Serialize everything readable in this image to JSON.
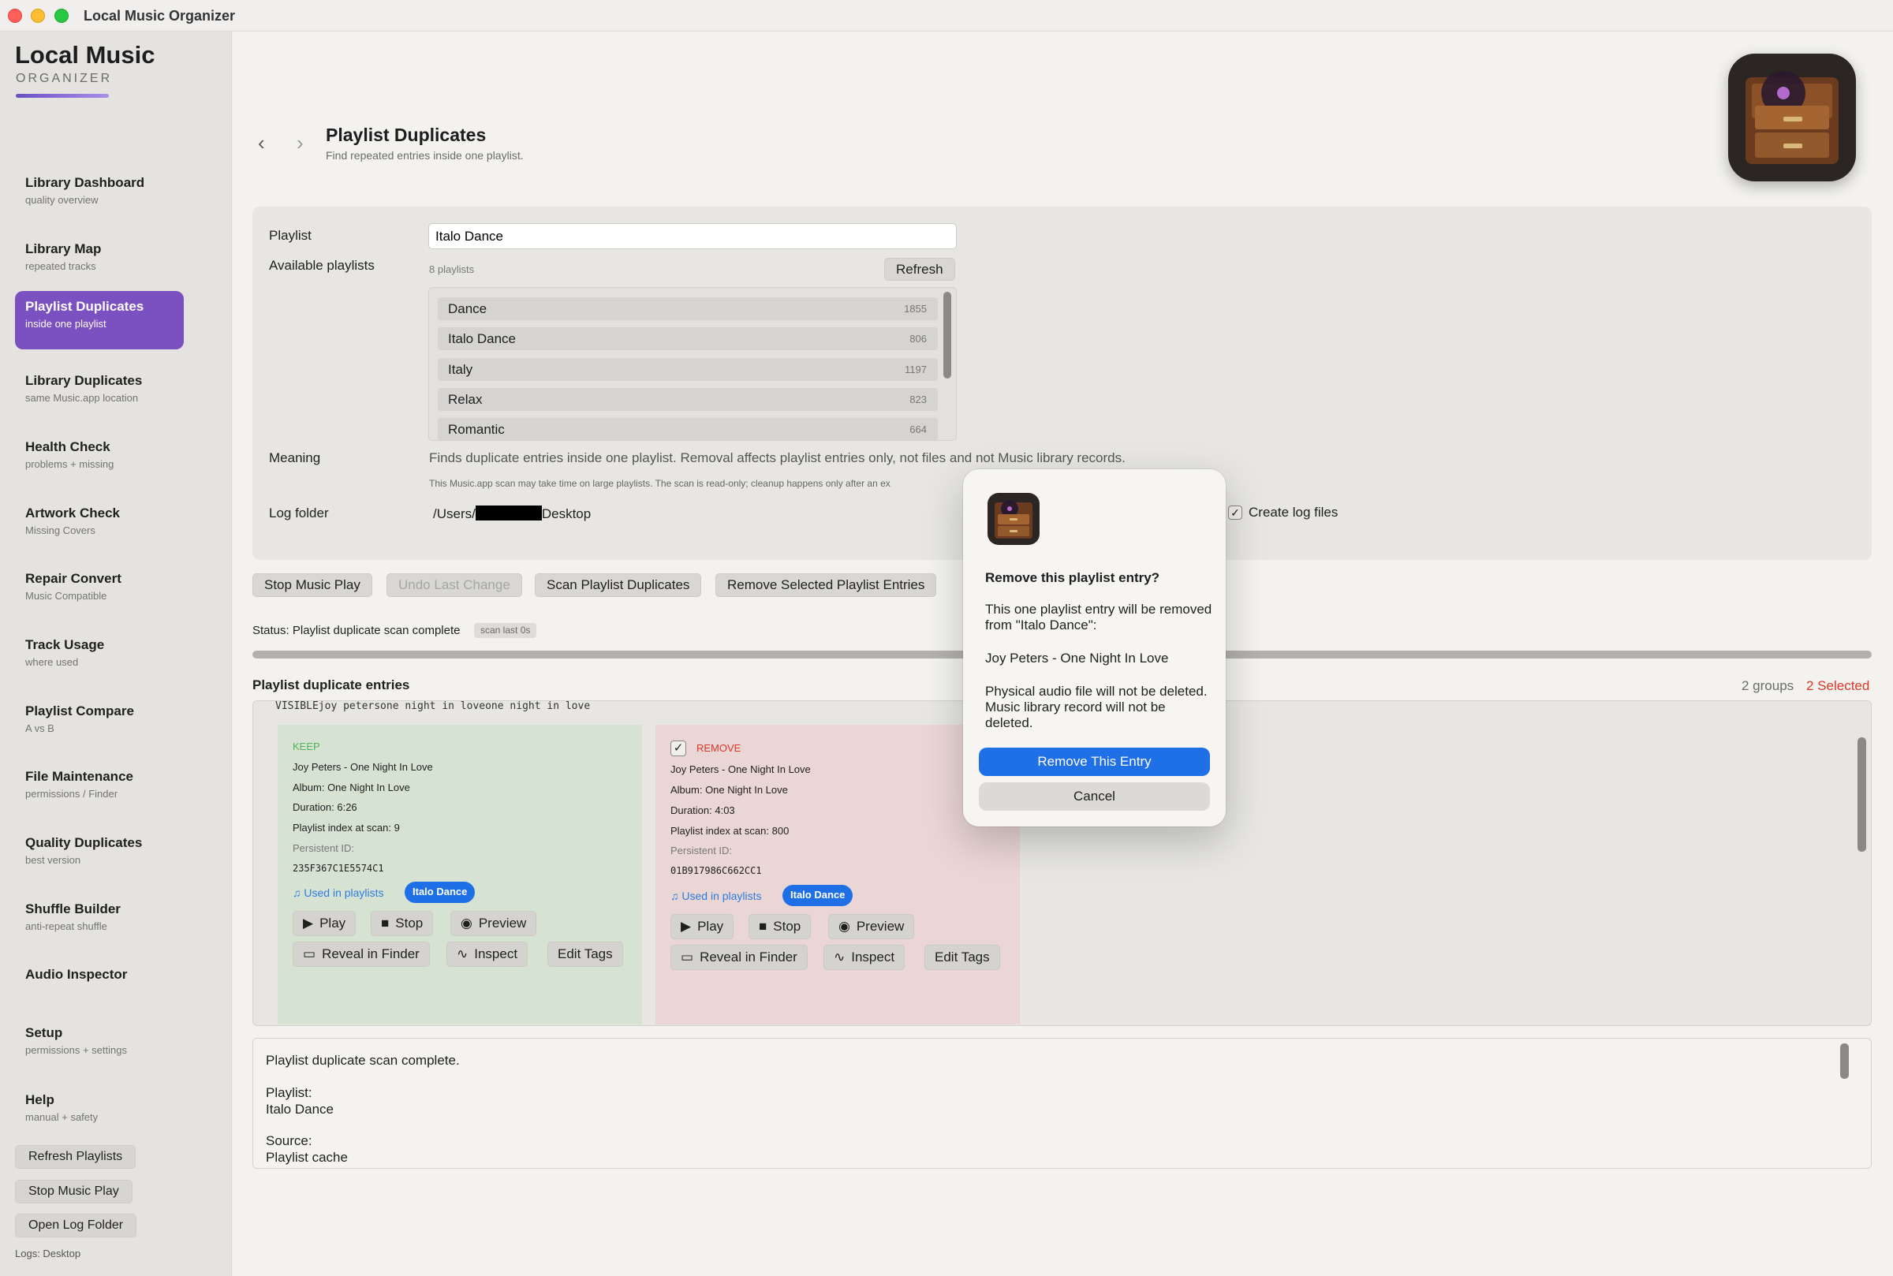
{
  "window": {
    "title": "Local Music Organizer"
  },
  "brand": {
    "name": "Local Music",
    "subtitle": "ORGANIZER"
  },
  "sidebar": {
    "items": [
      {
        "label": "Library Dashboard",
        "sub": "quality overview"
      },
      {
        "label": "Library Map",
        "sub": "repeated tracks"
      },
      {
        "label": "Playlist Duplicates",
        "sub": "inside one playlist"
      },
      {
        "label": "Library Duplicates",
        "sub": "same Music.app location"
      },
      {
        "label": "Health Check",
        "sub": "problems + missing"
      },
      {
        "label": "Artwork Check",
        "sub": "Missing Covers"
      },
      {
        "label": "Repair Convert",
        "sub": "Music Compatible"
      },
      {
        "label": "Track Usage",
        "sub": "where used"
      },
      {
        "label": "Playlist Compare",
        "sub": "A vs B"
      },
      {
        "label": "File Maintenance",
        "sub": "permissions / Finder"
      },
      {
        "label": "Quality Duplicates",
        "sub": "best version"
      },
      {
        "label": "Shuffle Builder",
        "sub": "anti-repeat shuffle"
      },
      {
        "label": "Audio Inspector",
        "sub": ""
      },
      {
        "label": "Setup",
        "sub": "permissions + settings"
      },
      {
        "label": "Help",
        "sub": "manual + safety"
      }
    ],
    "buttons": {
      "refresh_playlists": "Refresh Playlists",
      "stop_music_play": "Stop Music Play",
      "open_log_folder": "Open Log Folder"
    },
    "logs_label": "Logs: Desktop"
  },
  "header": {
    "back": "‹",
    "forward": "›",
    "title": "Playlist Duplicates",
    "subtitle": "Find repeated entries inside one playlist."
  },
  "form": {
    "playlist_label": "Playlist",
    "playlist_value": "Italo Dance",
    "available_label": "Available playlists",
    "playlist_count": "8 playlists",
    "refresh": "Refresh",
    "playlists": [
      {
        "name": "Dance",
        "count": "1855"
      },
      {
        "name": "Italo Dance",
        "count": "806"
      },
      {
        "name": "Italy",
        "count": "1197"
      },
      {
        "name": "Relax",
        "count": "823"
      },
      {
        "name": "Romantic",
        "count": "664"
      }
    ],
    "meaning_label": "Meaning",
    "meaning_text": "Finds duplicate entries inside one playlist. Removal affects playlist entries only, not files and not Music library records.",
    "meaning_note": "This Music.app scan may take time on large playlists. The scan is read-only; cleanup happens only after an ex",
    "log_folder_label": "Log folder",
    "log_folder_prefix": "/Users/",
    "log_folder_suffix": "Desktop",
    "create_log_files": "Create log files"
  },
  "actions": {
    "stop_music_play": "Stop Music Play",
    "undo_last_change": "Undo Last Change",
    "scan_playlist_duplicates": "Scan Playlist Duplicates",
    "remove_selected": "Remove Selected Playlist Entries"
  },
  "status": {
    "text": "Status: Playlist duplicate scan complete",
    "chip": "scan last 0s"
  },
  "results": {
    "title": "Playlist duplicate entries",
    "groups": "2 groups",
    "selected": "2 Selected",
    "visible_line": "VISIBLEjoy petersone night in loveone night in love",
    "keep": {
      "tag": "KEEP",
      "track": "Joy Peters - One Night In Love",
      "album": "Album: One Night In Love",
      "duration": "Duration: 6:26",
      "index": "Playlist index at scan: 9",
      "pid_label": "Persistent ID:",
      "pid": "235F367C1E5574C1",
      "used_in": "Used in playlists",
      "pill": "Italo Dance"
    },
    "remove": {
      "tag": "REMOVE",
      "track": "Joy Peters - One Night In Love",
      "album": "Album: One Night In Love",
      "duration": "Duration: 4:03",
      "index": "Playlist index at scan: 800",
      "pid_label": "Persistent ID:",
      "pid": "01B917986C662CC1",
      "used_in": "Used in playlists",
      "pill": "Italo Dance"
    },
    "buttons": {
      "play": "Play",
      "stop": "Stop",
      "preview": "Preview",
      "reveal": "Reveal in Finder",
      "inspect": "Inspect",
      "edit_tags": "Edit Tags"
    }
  },
  "log": {
    "lines": [
      "Playlist duplicate scan complete.",
      "Playlist:",
      "Italo Dance",
      "Source:",
      "Playlist cache"
    ]
  },
  "dialog": {
    "title": "Remove this playlist entry?",
    "body1": "This one playlist entry will be removed from \"Italo Dance\":",
    "track": "Joy Peters - One Night In Love",
    "body2": "Physical audio file will not be deleted. Music library record will not be deleted.",
    "confirm": "Remove This Entry",
    "cancel": "Cancel"
  },
  "colors": {
    "accent": "#7b50c1",
    "primary": "#1f6fe6",
    "remove": "#d9382a",
    "keep": "#53b35c"
  }
}
